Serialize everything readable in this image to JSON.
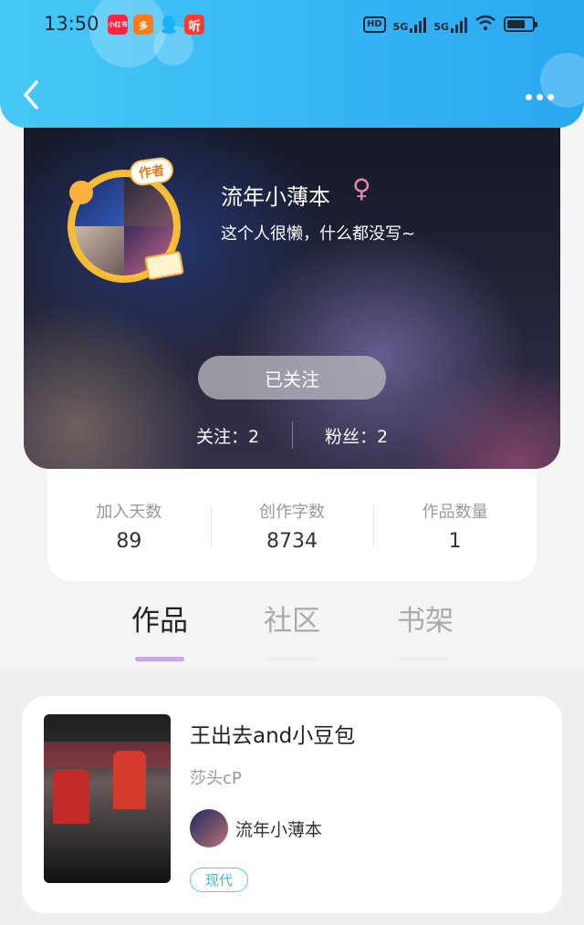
{
  "status_bar": {
    "time": "13:50",
    "apps": [
      "小红书",
      "多",
      "QQ",
      "听"
    ],
    "hd_label": "HD",
    "net_labels": [
      "5G",
      "5G"
    ],
    "battery_level": 0.72
  },
  "nav": {
    "back_icon": "chevron-left-icon",
    "more_icon": "more-icon"
  },
  "profile": {
    "badge": "作者",
    "username": "流年小薄本",
    "gender_symbol": "♀",
    "bio": "这个人很懒，什么都没写~",
    "follow_button": "已关注",
    "following": "关注：2",
    "followers": "粉丝：2"
  },
  "stats": [
    {
      "label": "加入天数",
      "value": "89"
    },
    {
      "label": "创作字数",
      "value": "8734"
    },
    {
      "label": "作品数量",
      "value": "1"
    }
  ],
  "tabs": [
    {
      "label": "作品",
      "active": true
    },
    {
      "label": "社区",
      "active": false
    },
    {
      "label": "书架",
      "active": false
    }
  ],
  "works": [
    {
      "title": "王出去and小豆包",
      "subtitle": "莎头cP",
      "author": "流年小薄本",
      "tag": "现代"
    }
  ],
  "colors": {
    "header": "#35b4f4",
    "tab_underline_active": "#c8a7e8",
    "tag": "#3fb2dd",
    "gender": "#ee82b0"
  }
}
